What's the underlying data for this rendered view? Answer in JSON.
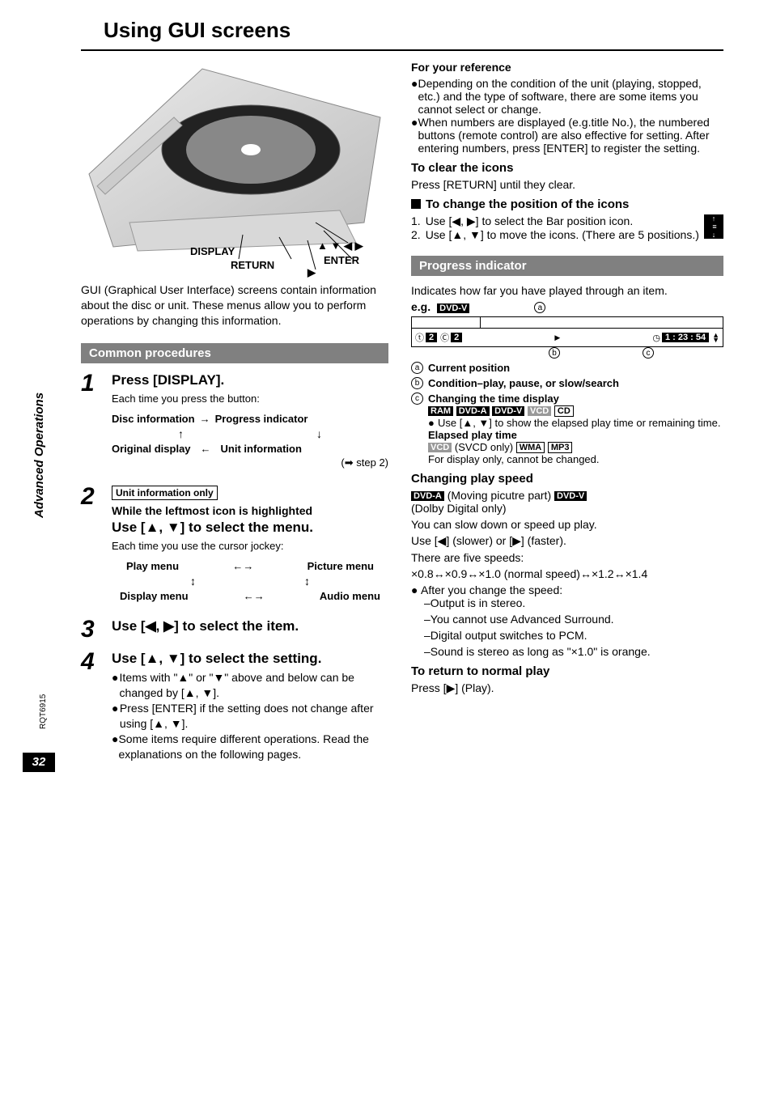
{
  "title": "Using GUI screens",
  "sidebar_label": "Advanced Operations",
  "page_number": "32",
  "rqt": "RQT6915",
  "device_callouts": {
    "display": "DISPLAY",
    "return": "RETURN",
    "arrows": "▲ ▼ ◀ ▶",
    "enter": "ENTER",
    "play": "▶"
  },
  "left": {
    "intro": "GUI (Graphical User Interface) screens contain information about the disc or unit. These menus allow you to perform operations by changing this information.",
    "section_header": "Common procedures",
    "steps": [
      {
        "num": "1",
        "heading": "Press [DISPLAY].",
        "sub": "Each time you press the button:",
        "cycle": {
          "top_left": "Disc information",
          "top_right": "Progress indicator",
          "bottom_left": "Original display",
          "bottom_right": "Unit information",
          "note": "(➡ step 2)"
        }
      },
      {
        "num": "2",
        "box_label": "Unit information only",
        "sub_bold": "While the leftmost icon is highlighted",
        "heading": "Use [▲, ▼] to select the menu.",
        "sub": "Each time you use the cursor jockey:",
        "cycle2": {
          "top_left": "Play menu",
          "top_right": "Picture menu",
          "bottom_left": "Display menu",
          "bottom_right": "Audio menu"
        }
      },
      {
        "num": "3",
        "heading": "Use [◀, ▶] to select the item."
      },
      {
        "num": "4",
        "heading": "Use [▲, ▼] to select the setting.",
        "bullets": [
          "Items with \"▲\" or \"▼\" above and below can be changed by [▲, ▼].",
          "Press [ENTER] if the setting does not change after using [▲, ▼].",
          "Some items require different operations. Read the explanations on the following pages."
        ]
      }
    ]
  },
  "right": {
    "ref_header": "For your reference",
    "ref_bullets": [
      "Depending on the condition of the unit (playing, stopped, etc.) and the type of software, there are some items you cannot select or change.",
      "When numbers are displayed (e.g.title No.), the numbered buttons (remote control) are also effective for setting. After entering numbers, press [ENTER] to register the setting."
    ],
    "clear_header": "To clear the icons",
    "clear_body": "Press [RETURN] until they clear.",
    "pos_header": "To change the position of the icons",
    "pos_steps": [
      "Use [◀, ▶] to select the Bar position icon.",
      "Use [▲, ▼] to move the icons. (There are 5 positions.)"
    ],
    "section_header": "Progress indicator",
    "progress_intro": "Indicates how far you have played through an item.",
    "eg_label": "e.g.",
    "eg_badge": "DVD-V",
    "progress_bar": {
      "title_num": "2",
      "chapter_num": "2",
      "state": "▶",
      "time": "1 : 23 : 54",
      "annot_a": "a",
      "annot_b": "b",
      "annot_c": "c"
    },
    "annotations": [
      {
        "letter": "a",
        "label": "Current position"
      },
      {
        "letter": "b",
        "label": "Condition–play, pause, or slow/search"
      },
      {
        "letter": "c",
        "label": "Changing the time display",
        "badges": [
          "RAM",
          "DVD-A",
          "DVD-V",
          "VCD",
          "CD"
        ],
        "bullets": [
          "Use [▲,  ▼] to show the elapsed play time or remaining time."
        ],
        "sub_heading": "Elapsed play time",
        "sub_badges": [
          {
            "t": "VCD",
            "c": "gray"
          },
          {
            "t": "(SVCD only)",
            "c": "plain"
          },
          {
            "t": "WMA",
            "c": "out"
          },
          {
            "t": "MP3",
            "c": "out"
          }
        ],
        "sub_note": "For display only, cannot be changed."
      }
    ],
    "speed_header": "Changing play speed",
    "speed_badges": [
      {
        "t": "DVD-A",
        "c": "dark"
      },
      {
        "t": "(Moving picutre part)",
        "c": "plain"
      },
      {
        "t": "DVD-V",
        "c": "dark"
      }
    ],
    "speed_lines": [
      "(Dolby Digital only)",
      "You can slow down or speed up play.",
      "Use [◀] (slower) or [▶] (faster).",
      "There are five speeds:",
      "×0.8↔×0.9↔×1.0 (normal speed)↔×1.2↔×1.4"
    ],
    "speed_after": "After you change the speed:",
    "speed_after_items": [
      "–Output is in stereo.",
      "–You cannot use Advanced Surround.",
      "–Digital output switches to PCM.",
      "–Sound is stereo as long as \"×1.0\" is orange."
    ],
    "return_header": "To return to normal play",
    "return_body": "Press [▶] (Play)."
  }
}
